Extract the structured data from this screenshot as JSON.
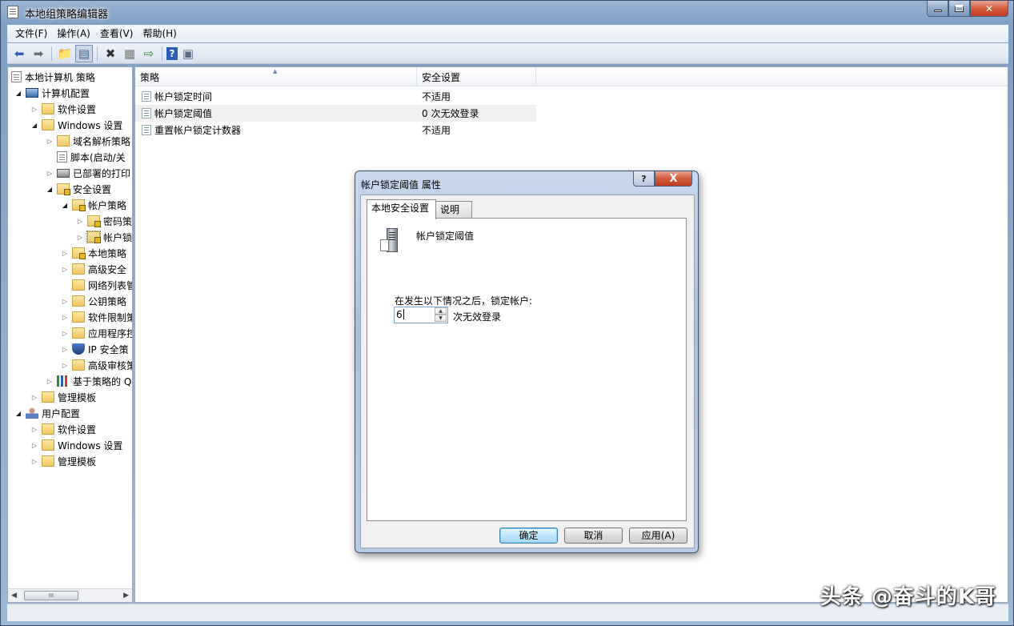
{
  "window": {
    "title": "本地组策略编辑器"
  },
  "menu": [
    "文件(F)",
    "操作(A)",
    "查看(V)",
    "帮助(H)"
  ],
  "toolbar": {
    "icons": [
      "back-arrow-icon",
      "forward-arrow-icon",
      "up-folder-icon",
      "show-hide-tree-icon",
      "delete-icon",
      "properties-icon",
      "export-list-icon",
      "help-icon",
      "view-icon"
    ]
  },
  "tree": {
    "items": [
      {
        "label": "本地计算机 策略",
        "icon": "doc"
      },
      {
        "label": "计算机配置",
        "icon": "computer"
      },
      {
        "label": "软件设置",
        "icon": "folder"
      },
      {
        "label": "Windows 设置",
        "icon": "folder"
      },
      {
        "label": "域名解析策略",
        "icon": "folder"
      },
      {
        "label": "脚本(启动/关",
        "icon": "doc"
      },
      {
        "label": "已部署的打印",
        "icon": "printer"
      },
      {
        "label": "安全设置",
        "icon": "folder-lock"
      },
      {
        "label": "帐户策略",
        "icon": "folder-lock"
      },
      {
        "label": "密码策",
        "icon": "folder-lock"
      },
      {
        "label": "帐户锁",
        "icon": "folder-lock"
      },
      {
        "label": "本地策略",
        "icon": "folder-lock"
      },
      {
        "label": "高级安全",
        "icon": "folder"
      },
      {
        "label": "网络列表管",
        "icon": "folder"
      },
      {
        "label": "公钥策略",
        "icon": "folder"
      },
      {
        "label": "软件限制策",
        "icon": "folder"
      },
      {
        "label": "应用程序控",
        "icon": "folder"
      },
      {
        "label": "IP 安全策",
        "icon": "shield"
      },
      {
        "label": "高级审核策",
        "icon": "folder"
      },
      {
        "label": "基于策略的 Q",
        "icon": "chart"
      },
      {
        "label": "管理模板",
        "icon": "folder"
      },
      {
        "label": "用户配置",
        "icon": "user"
      },
      {
        "label": "软件设置",
        "icon": "folder"
      },
      {
        "label": "Windows 设置",
        "icon": "folder"
      },
      {
        "label": "管理模板",
        "icon": "folder"
      }
    ],
    "scroll_thumb_glyph": "III"
  },
  "list": {
    "columns": [
      "策略",
      "安全设置"
    ],
    "rows": [
      {
        "name": "帐户锁定时间",
        "value": "不适用"
      },
      {
        "name": "帐户锁定阈值",
        "value": "0 次无效登录"
      },
      {
        "name": "重置帐户锁定计数器",
        "value": "不适用"
      }
    ]
  },
  "dialog": {
    "title": "帐户锁定阈值 属性",
    "help_glyph": "?",
    "close_glyph": "X",
    "tabs": [
      "本地安全设置",
      "说明"
    ],
    "policy_name": "帐户锁定阈值",
    "prompt": "在发生以下情况之后，锁定帐户:",
    "spin_value": "6",
    "unit": "次无效登录",
    "buttons": {
      "ok": "确定",
      "cancel": "取消",
      "apply": "应用(A)"
    }
  },
  "watermark": "头条 @奋斗的K哥"
}
